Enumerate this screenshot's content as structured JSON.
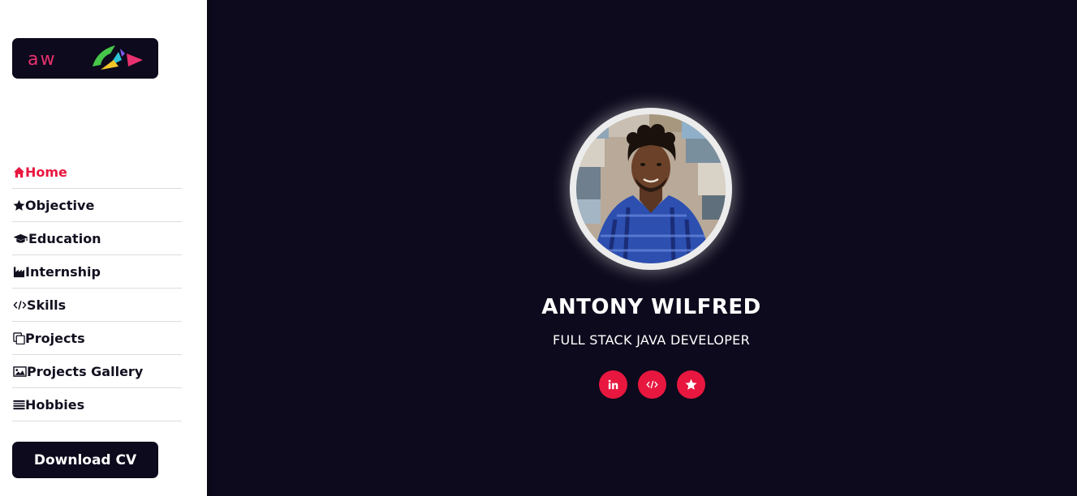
{
  "logo": {
    "text": "aw"
  },
  "nav": {
    "items": [
      {
        "label": "Home",
        "icon": "home-icon",
        "active": true
      },
      {
        "label": "Objective",
        "icon": "star-icon"
      },
      {
        "label": "Education",
        "icon": "graduation-cap-icon"
      },
      {
        "label": "Internship",
        "icon": "industry-icon"
      },
      {
        "label": "Skills",
        "icon": "code-icon"
      },
      {
        "label": "Projects",
        "icon": "copy-icon"
      },
      {
        "label": "Projects Gallery",
        "icon": "image-icon"
      },
      {
        "label": "Hobbies",
        "icon": "list-icon"
      }
    ]
  },
  "download_cv": {
    "label": "Download CV"
  },
  "profile": {
    "name": "ANTONY WILFRED",
    "title": "FULL STACK JAVA DEVELOPER"
  },
  "socials": [
    {
      "icon": "linkedin-icon"
    },
    {
      "icon": "code-icon"
    },
    {
      "icon": "star-icon"
    }
  ],
  "colors": {
    "accent": "#e8173f",
    "dark": "#0c0a1c",
    "logo_text": "#e8316f"
  }
}
